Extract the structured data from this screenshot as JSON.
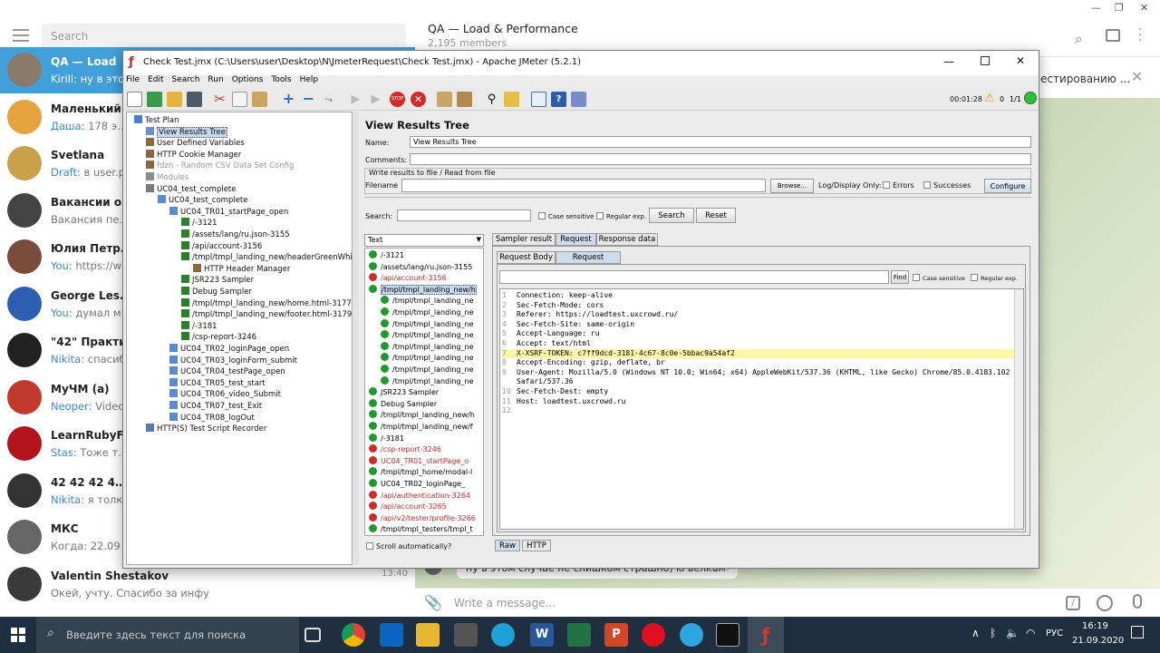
{
  "telegram": {
    "search_placeholder": "Search",
    "chats": [
      {
        "name": "QA — Load",
        "preview_sender": "Kirill:",
        "preview": " ну в этом",
        "avatar_color": "#8a7a6a",
        "selected": true
      },
      {
        "name": "Маленький",
        "preview_sender": "Даша:",
        "preview": " 178 это х",
        "avatar_color": "#e6a23c"
      },
      {
        "name": "Svetlana",
        "preview_sender": "Draft:",
        "preview": " в user.pr",
        "avatar_color": "#c9a04a"
      },
      {
        "name": "Вакансии о",
        "preview_sender": "",
        "preview": "Вакансия перес",
        "avatar_color": "#444444"
      },
      {
        "name": "Юлия Петрова",
        "preview_sender": "You:",
        "preview": " https://www",
        "avatar_color": "#7a4a3a"
      },
      {
        "name": "George Lesmer",
        "preview_sender": "You:",
        "preview": " думал мал",
        "avatar_color": "#2c5fb0"
      },
      {
        "name": "\"42\" Практи",
        "preview_sender": "Nikita:",
        "preview": " спасибо",
        "avatar_color": "#222222"
      },
      {
        "name": "МуЧМ (а)",
        "preview_sender": "Neoper:",
        "preview": " Video,",
        "avatar_color": "#c0392b"
      },
      {
        "name": "LearnRubyF",
        "preview_sender": "Stas:",
        "preview": " Тоже труж",
        "avatar_color": "#b3141c"
      },
      {
        "name": "42 42 42 42 4",
        "preview_sender": "Nikita:",
        "preview": " я толк",
        "avatar_color": "#333333"
      },
      {
        "name": "МКС",
        "preview_sender": "",
        "preview": "Когда: 22.09 ,",
        "avatar_color": "#666666"
      },
      {
        "name": "Valentin Shestakov",
        "preview_sender": "",
        "preview": "Окей, учту. Спасибо за инфу",
        "avatar_color": "#3a3a3a",
        "time": "13:40"
      }
    ],
    "chat_title": "QA — Load & Performance",
    "members": "2,195 members",
    "pinned_text": "естированию ...",
    "message_text": "ну в этом случае не слишком страшно) ю велкам",
    "message_time": "16:19",
    "compose_placeholder": "Write a message..."
  },
  "jmeter": {
    "window_title": "Check Test.jmx (C:\\Users\\user\\Desktop\\N\\JmeterRequest\\Check Test.jmx) - Apache JMeter (5.2.1)",
    "menu": [
      "File",
      "Edit",
      "Search",
      "Run",
      "Options",
      "Tools",
      "Help"
    ],
    "timer": "00:01:28",
    "warnings": "0",
    "threads": "1/1",
    "tree": [
      {
        "label": "Test Plan",
        "depth": 0,
        "kind": "plan"
      },
      {
        "label": "View Results Tree",
        "depth": 1,
        "kind": "listener",
        "selected": true
      },
      {
        "label": "User Defined Variables",
        "depth": 1,
        "kind": "config"
      },
      {
        "label": "HTTP Cookie Manager",
        "depth": 1,
        "kind": "config"
      },
      {
        "label": "fdzn - Random CSV Data Set Config",
        "depth": 1,
        "kind": "config",
        "disabled": true
      },
      {
        "label": "Modules",
        "depth": 1,
        "kind": "module",
        "disabled": true
      },
      {
        "label": "UC04_test_complete",
        "depth": 1,
        "kind": "thread"
      },
      {
        "label": "UC04_test_complete",
        "depth": 2,
        "kind": "controller"
      },
      {
        "label": "UC04_TR01_startPage_open",
        "depth": 3,
        "kind": "controller"
      },
      {
        "label": "/-3121",
        "depth": 4,
        "kind": "sampler"
      },
      {
        "label": "/assets/lang/ru.json-3155",
        "depth": 4,
        "kind": "sampler"
      },
      {
        "label": "/api/account-3156",
        "depth": 4,
        "kind": "sampler"
      },
      {
        "label": "/tmpl/tmpl_landing_new/headerGreenWhite.html",
        "depth": 4,
        "kind": "sampler"
      },
      {
        "label": "HTTP Header Manager",
        "depth": 5,
        "kind": "config"
      },
      {
        "label": "JSR223 Sampler",
        "depth": 4,
        "kind": "sampler"
      },
      {
        "label": "Debug Sampler",
        "depth": 4,
        "kind": "sampler"
      },
      {
        "label": "/tmpl/tmpl_landing_new/home.html-3177",
        "depth": 4,
        "kind": "sampler"
      },
      {
        "label": "/tmpl/tmpl_landing_new/footer.html-3179",
        "depth": 4,
        "kind": "sampler"
      },
      {
        "label": "/-3181",
        "depth": 4,
        "kind": "sampler"
      },
      {
        "label": "/csp-report-3246",
        "depth": 4,
        "kind": "sampler"
      },
      {
        "label": "UC04_TR02_loginPage_open",
        "depth": 3,
        "kind": "controller"
      },
      {
        "label": "UC04_TR03_loginForm_submit",
        "depth": 3,
        "kind": "controller"
      },
      {
        "label": "UC04_TR04_testPage_open",
        "depth": 3,
        "kind": "controller"
      },
      {
        "label": "UC04_TR05_test_start",
        "depth": 3,
        "kind": "controller"
      },
      {
        "label": "UC04_TR06_video_Submit",
        "depth": 3,
        "kind": "controller"
      },
      {
        "label": "UC04_TR07_test_Exit",
        "depth": 3,
        "kind": "controller"
      },
      {
        "label": "UC04_TR08_logOut",
        "depth": 3,
        "kind": "controller"
      },
      {
        "label": "HTTP(S) Test Script Recorder",
        "depth": 1,
        "kind": "recorder"
      }
    ],
    "panel": {
      "title": "View Results Tree",
      "name_label": "Name:",
      "name_value": "View Results Tree",
      "comments_label": "Comments:",
      "write_results": "Write results to file / Read from file",
      "filename_label": "Filename",
      "browse": "Browse...",
      "log_display": "Log/Display Only:",
      "errors": "Errors",
      "successes": "Successes",
      "configure": "Configure",
      "search_label": "Search:",
      "case_sensitive": "Case sensitive",
      "regular_exp": "Regular exp.",
      "search_btn": "Search",
      "reset_btn": "Reset",
      "renderer": "Text",
      "tabs": [
        "Sampler result",
        "Request",
        "Response data"
      ],
      "subtabs": [
        "Request Body",
        "Request Headers"
      ],
      "find": "Find",
      "scroll_auto": "Scroll automatically?",
      "bottom_tabs": [
        "Raw",
        "HTTP"
      ]
    },
    "results": [
      {
        "label": "/-3121",
        "ok": true,
        "depth": 0
      },
      {
        "label": "/assets/lang/ru.json-3155",
        "ok": true,
        "depth": 0
      },
      {
        "label": "/api/account-3156",
        "ok": false,
        "depth": 0
      },
      {
        "label": "/tmpl/tmpl_landing_new/h",
        "ok": true,
        "depth": 0,
        "selected": true
      },
      {
        "label": "/tmpl/tmpl_landing_ne",
        "ok": true,
        "depth": 1
      },
      {
        "label": "/tmpl/tmpl_landing_ne",
        "ok": true,
        "depth": 1
      },
      {
        "label": "/tmpl/tmpl_landing_ne",
        "ok": true,
        "depth": 1
      },
      {
        "label": "/tmpl/tmpl_landing_ne",
        "ok": true,
        "depth": 1
      },
      {
        "label": "/tmpl/tmpl_landing_ne",
        "ok": true,
        "depth": 1
      },
      {
        "label": "/tmpl/tmpl_landing_ne",
        "ok": true,
        "depth": 1
      },
      {
        "label": "/tmpl/tmpl_landing_ne",
        "ok": true,
        "depth": 1
      },
      {
        "label": "/tmpl/tmpl_landing_ne",
        "ok": true,
        "depth": 1
      },
      {
        "label": "JSR223 Sampler",
        "ok": true,
        "depth": 0
      },
      {
        "label": "Debug Sampler",
        "ok": true,
        "depth": 0
      },
      {
        "label": "/tmpl/tmpl_landing_new/h",
        "ok": true,
        "depth": 0
      },
      {
        "label": "/tmpl/tmpl_landing_new/f",
        "ok": true,
        "depth": 0
      },
      {
        "label": "/-3181",
        "ok": true,
        "depth": 0
      },
      {
        "label": "/csp-report-3246",
        "ok": false,
        "depth": 0
      },
      {
        "label": "UC04_TR01_startPage_o",
        "ok": false,
        "depth": 0
      },
      {
        "label": "/tmpl/tmpl_home/modal-l",
        "ok": true,
        "depth": 0
      },
      {
        "label": "UC04_TR02_loginPage_",
        "ok": true,
        "depth": 0
      },
      {
        "label": "/api/authentication-3264",
        "ok": false,
        "depth": 0
      },
      {
        "label": "/api/account-3265",
        "ok": false,
        "depth": 0
      },
      {
        "label": "/api/v2/tester/profile-3266",
        "ok": false,
        "depth": 0
      },
      {
        "label": "/tmpl/tmpl_testers/tmpl_t",
        "ok": true,
        "depth": 0
      }
    ],
    "headers": [
      {
        "n": "1",
        "t": "Connection: keep-alive"
      },
      {
        "n": "2",
        "t": "Sec-Fetch-Mode: cors"
      },
      {
        "n": "3",
        "t": "Referer: https://loadtest.uxcrowd.ru/"
      },
      {
        "n": "4",
        "t": "Sec-Fetch-Site: same-origin"
      },
      {
        "n": "5",
        "t": "Accept-Language: ru"
      },
      {
        "n": "6",
        "t": "Accept: text/html"
      },
      {
        "n": "7",
        "t": "X-XSRF-TOKEN: c7ff9dcd-3181-4c67-8c0e-5bbac9a54af2",
        "hl": true
      },
      {
        "n": "8",
        "t": "Accept-Encoding: gzip, deflate, br"
      },
      {
        "n": "9",
        "t": "User-Agent: Mozilla/5.0 (Windows NT 10.0; Win64; x64) AppleWebKit/537.36 (KHTML, like Gecko) Chrome/85.0.4183.102"
      },
      {
        "n": "",
        "t": "Safari/537.36"
      },
      {
        "n": "10",
        "t": "Sec-Fetch-Dest: empty"
      },
      {
        "n": "11",
        "t": "Host: loadtest.uxcrowd.ru"
      },
      {
        "n": "12",
        "t": ""
      }
    ]
  },
  "taskbar": {
    "search_placeholder": "Введите здесь текст для поиска",
    "language": "РУС",
    "time": "16:19",
    "date": "21.09.2020"
  }
}
